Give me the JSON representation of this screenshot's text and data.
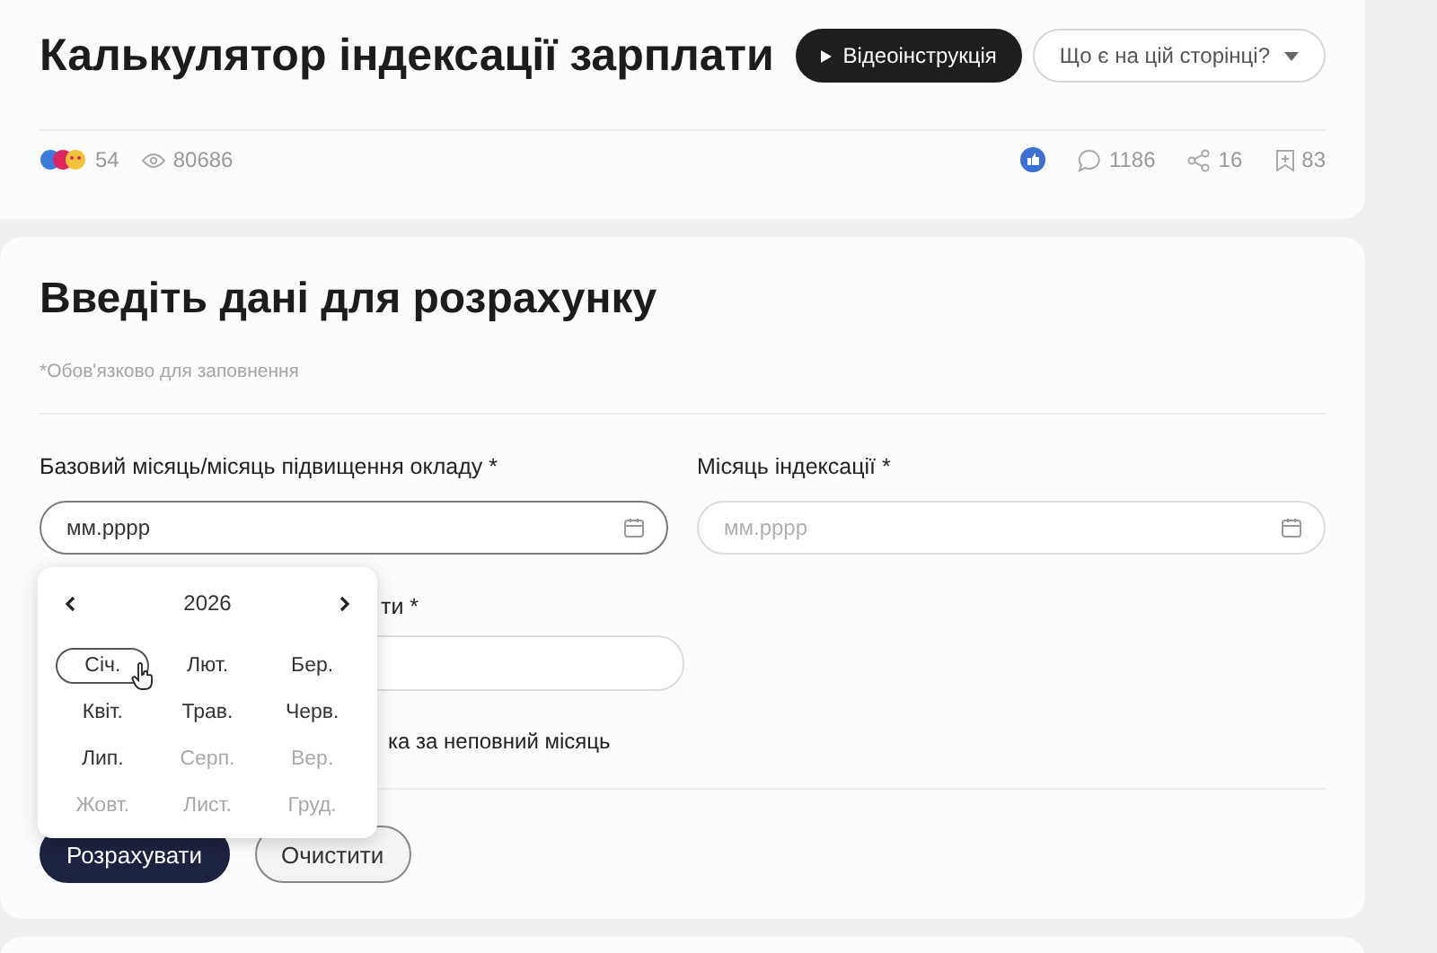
{
  "header": {
    "title": "Калькулятор індексації зарплати",
    "video_button": {
      "label": "Відеоінструкція"
    },
    "help_dropdown": {
      "label": "Що є на цій сторінці?"
    }
  },
  "stats": {
    "reactions": "54",
    "views": "80686",
    "comments": "1186",
    "shares": "16",
    "bookmarks": "83"
  },
  "form": {
    "title": "Введіть дані для розрахунку",
    "required_note": "*Обов'язково для заповнення",
    "fields": [
      {
        "label": "Базовий місяць/місяць підвищення окладу *",
        "placeholder": "мм.рррр",
        "focused": true
      },
      {
        "label": "Місяць індексації *",
        "placeholder": "мм.рррр",
        "focused": false
      }
    ],
    "partial_field": {
      "label": "ти *"
    },
    "partial_option": "ка за неповний місяць",
    "buttons": [
      {
        "label": "Розрахувати",
        "kind": "primary"
      },
      {
        "label": "Очистити",
        "kind": "secondary"
      }
    ]
  },
  "month_picker": {
    "year": "2026",
    "months": [
      {
        "label": "Січ.",
        "highlighted": true,
        "disabled": false
      },
      {
        "label": "Лют.",
        "highlighted": false,
        "disabled": false
      },
      {
        "label": "Бер.",
        "highlighted": false,
        "disabled": false
      },
      {
        "label": "Квіт.",
        "highlighted": false,
        "disabled": false
      },
      {
        "label": "Трав.",
        "highlighted": false,
        "disabled": false
      },
      {
        "label": "Черв.",
        "highlighted": false,
        "disabled": false
      },
      {
        "label": "Лип.",
        "highlighted": false,
        "disabled": false
      },
      {
        "label": "Серп.",
        "highlighted": false,
        "disabled": true
      },
      {
        "label": "Вер.",
        "highlighted": false,
        "disabled": true
      },
      {
        "label": "Жовт.",
        "highlighted": false,
        "disabled": true
      },
      {
        "label": "Лист.",
        "highlighted": false,
        "disabled": true
      },
      {
        "label": "Груд.",
        "highlighted": false,
        "disabled": true
      }
    ]
  }
}
